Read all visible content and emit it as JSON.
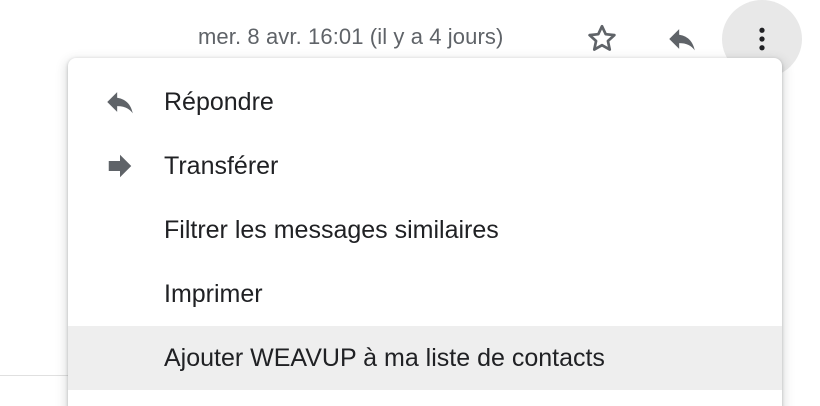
{
  "header": {
    "timestamp": "mer. 8 avr. 16:01 (il y a 4 jours)",
    "icons": {
      "star": "star-outline-icon",
      "reply": "reply-icon",
      "more": "more-vertical-icon"
    }
  },
  "menu": {
    "items": [
      {
        "label": "Répondre",
        "icon": "reply-icon"
      },
      {
        "label": "Transférer",
        "icon": "forward-icon"
      },
      {
        "label": "Filtrer les messages similaires",
        "icon": ""
      },
      {
        "label": "Imprimer",
        "icon": ""
      },
      {
        "label": "Ajouter WEAVUP à ma liste de contacts",
        "icon": "",
        "highlighted": true
      }
    ]
  },
  "colors": {
    "icon_gray": "#5f6368",
    "text": "#202124",
    "hover_bg": "#eeeeee"
  }
}
